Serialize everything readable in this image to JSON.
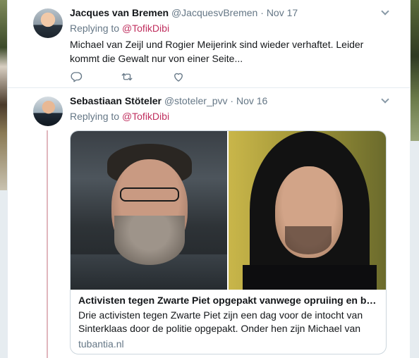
{
  "tweets": [
    {
      "name": "Jacques van Bremen",
      "handle": "@JacquesvBremen",
      "separator": "·",
      "time": "Nov 17",
      "replying_label": "Replying to",
      "replying_to": "@TofikDibi",
      "text": "Michael van Zeijl und Rogier Meijerink sind wieder verhaftet. Leider kommt die Gewalt nur von einer Seite...",
      "actions": [
        "reply-icon",
        "retweet-icon",
        "like-icon"
      ]
    },
    {
      "name": "Sebastiaan Stöteler",
      "handle": "@stoteler_pvv",
      "separator": "·",
      "time": "Nov 16",
      "replying_label": "Replying to",
      "replying_to": "@TofikDibi",
      "card": {
        "title": "Activisten tegen Zwarte Piet opgepakt vanwege opruiing en bed...",
        "description": "Drie activisten tegen Zwarte Piet zijn een dag voor de intocht van Sinterklaas door de politie opgepakt. Onder hen zijn Michael van Zeijl ...",
        "domain": "tubantia.nl"
      }
    }
  ],
  "colors": {
    "mention": "#c0305f",
    "secondary_text": "#657786",
    "thread_line": "#e1b6bd",
    "border": "#e6ecf0"
  }
}
